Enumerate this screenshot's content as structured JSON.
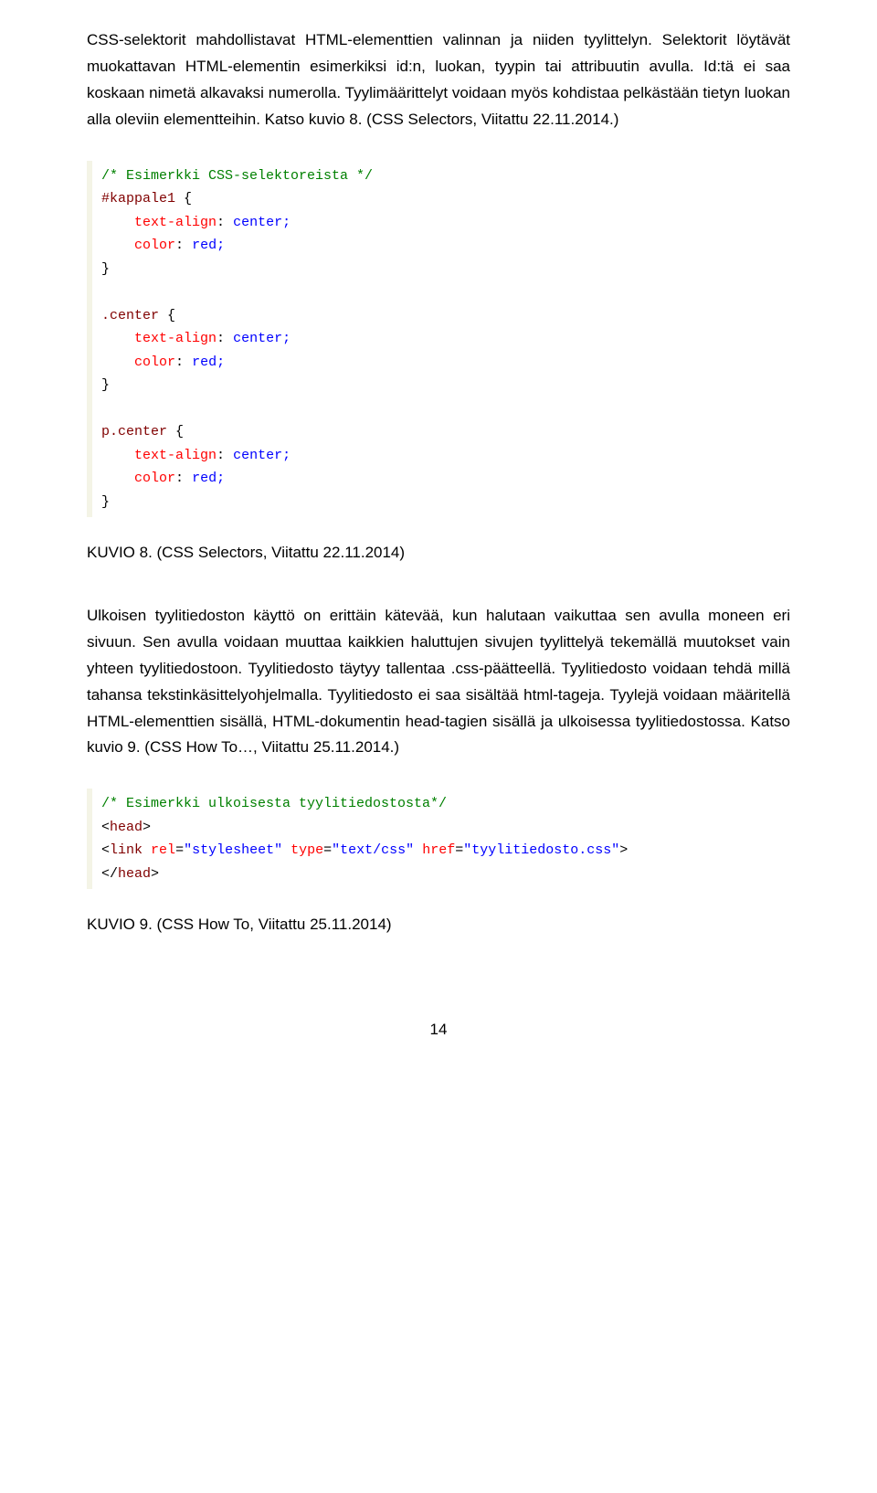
{
  "para1": "CSS-selektorit mahdollistavat HTML-elementtien valinnan ja niiden tyylittelyn. Selektorit löytävät muokattavan HTML-elementin esimerkiksi id:n, luokan, tyypin tai attribuutin avulla. Id:tä ei saa koskaan nimetä alkavaksi numerolla. Tyylimäärittelyt voidaan myös kohdistaa pelkästään tietyn luokan alla oleviin elementteihin. Katso kuvio 8. (CSS Selectors, Viitattu 22.11.2014.)",
  "code1": {
    "c1": "/* Esimerkki CSS-selektoreista */",
    "s1": "#kappale1",
    "p1a": "text-align",
    "v1a": "center;",
    "p1b": "color",
    "v1b": "red;",
    "s2": ".center",
    "s3a": "p",
    "s3b": ".center"
  },
  "kuvio8": "KUVIO 8. (CSS Selectors, Viitattu 22.11.2014)",
  "para2": "Ulkoisen tyylitiedoston käyttö on erittäin kätevää, kun halutaan vaikuttaa sen avulla moneen eri sivuun. Sen avulla voidaan muuttaa kaikkien haluttujen sivujen tyylittelyä tekemällä muutokset vain yhteen tyylitiedostoon. Tyylitiedosto täytyy tallentaa .css-päätteellä. Tyylitiedosto voidaan tehdä millä tahansa tekstinkäsittelyohjelmalla. Tyylitiedosto ei saa sisältää html-tageja. Tyylejä voidaan määritellä HTML-elementtien sisällä, HTML-dokumentin head-tagien sisällä ja ulkoisessa tyylitiedostossa. Katso kuvio 9. (CSS How To…, Viitattu 25.11.2014.)",
  "code2": {
    "c1": "/* Esimerkki ulkoisesta tyylitiedostosta*/",
    "t1": "head",
    "t2": "link",
    "a1n": "rel",
    "a1v": "\"stylesheet\"",
    "a2n": "type",
    "a2v": "\"text/css\"",
    "a3n": "href",
    "a3v": "\"tyylitiedosto.css\"",
    "t3": "head"
  },
  "kuvio9": "KUVIO 9. (CSS How To, Viitattu 25.11.2014)",
  "pagenum": "14"
}
